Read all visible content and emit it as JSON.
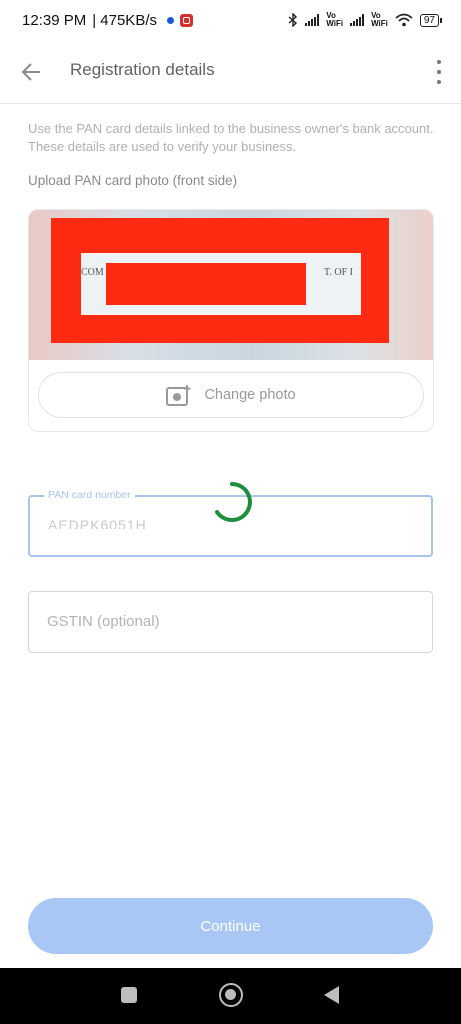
{
  "status_bar": {
    "time": "12:39 PM",
    "speed": "| 475KB/s",
    "volte_1_top": "Vo",
    "volte_1_bottom": "WiFi",
    "volte_2_top": "Vo",
    "volte_2_bottom": "WiFi",
    "battery": "97"
  },
  "app_bar": {
    "title": "Registration details",
    "back_icon": "arrow-back-icon",
    "menu_icon": "more-vert-icon"
  },
  "intro_text": "Use the PAN card details linked to the business owner's bank account. These details are used to verify your business.",
  "upload": {
    "label": "Upload PAN card photo (front side)",
    "card_text_left": "COM",
    "card_text_right": "T. OF I",
    "change_label": "Change photo",
    "change_icon": "add-photo-icon"
  },
  "pan_field": {
    "label": "PAN card number",
    "value": "AEDPK6051H"
  },
  "gstin_field": {
    "placeholder": "GSTIN (optional)"
  },
  "continue": {
    "label": "Continue"
  },
  "colors": {
    "accent": "#1a73e8",
    "spinner": "#1e8e3e",
    "redaction": "#ff2a12",
    "button_disabled": "#a8c7f4"
  }
}
